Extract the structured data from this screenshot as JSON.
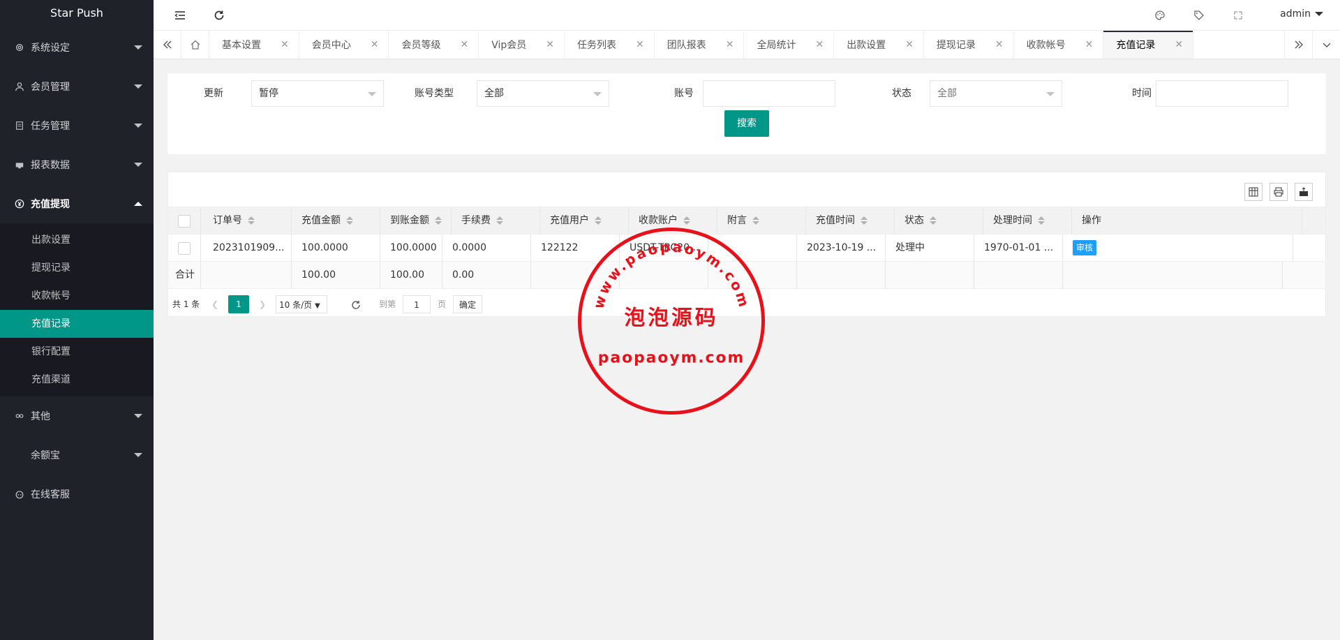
{
  "app": {
    "title": "Star Push",
    "user": "admin"
  },
  "sidebar": {
    "items": [
      {
        "label": "系统设定",
        "icon": "gear-icon"
      },
      {
        "label": "会员管理",
        "icon": "user-icon"
      },
      {
        "label": "任务管理",
        "icon": "doc-icon"
      },
      {
        "label": "报表数据",
        "icon": "chart-icon"
      },
      {
        "label": "充值提现",
        "icon": "yen-icon"
      }
    ],
    "submenu": [
      "出款设置",
      "提现记录",
      "收款帐号",
      "充值记录",
      "银行配置",
      "充值渠道"
    ],
    "bottom": [
      {
        "label": "其他",
        "icon": "link-icon"
      },
      {
        "label": "余额宝",
        "icon": ""
      },
      {
        "label": "在线客服",
        "icon": "service-icon"
      }
    ]
  },
  "tabs": [
    "基本设置",
    "会员中心",
    "会员等级",
    "Vip会员",
    "任务列表",
    "团队报表",
    "全局统计",
    "出款设置",
    "提现记录",
    "收款帐号",
    "充值记录"
  ],
  "filter": {
    "update_label": "更新",
    "update_value": "暂停",
    "acct_type_label": "账号类型",
    "acct_type_value": "全部",
    "account_label": "账号",
    "account_value": "",
    "status_label": "状态",
    "status_value": "全部",
    "time_label": "时间",
    "time_value": "",
    "search_label": "搜索"
  },
  "table": {
    "headers": [
      "订单号",
      "充值金额",
      "到账金额",
      "手续费",
      "充值用户",
      "收款账户",
      "附言",
      "充值时间",
      "状态",
      "处理时间",
      "操作"
    ],
    "row": {
      "order": "2023101909...",
      "amount": "100.0000",
      "received": "100.0000",
      "fee": "0.0000",
      "user": "122122",
      "account": "USDT-TRC20...",
      "note": "",
      "time": "2023-10-19 ...",
      "status": "处理中",
      "processed": "1970-01-01 ...",
      "action": "审核"
    },
    "total": {
      "label": "合计",
      "amount": "100.00",
      "received": "100.00",
      "fee": "0.00"
    }
  },
  "pager": {
    "total_text": "共 1 条",
    "current": "1",
    "per_page": "10 条/页",
    "goto_label": "到第",
    "goto_value": "1",
    "page_label": "页",
    "confirm": "确定"
  },
  "stamp": {
    "url_text": "www.paopaoym.com",
    "name": "泡泡源码",
    "domain": "paopaoym.com"
  }
}
